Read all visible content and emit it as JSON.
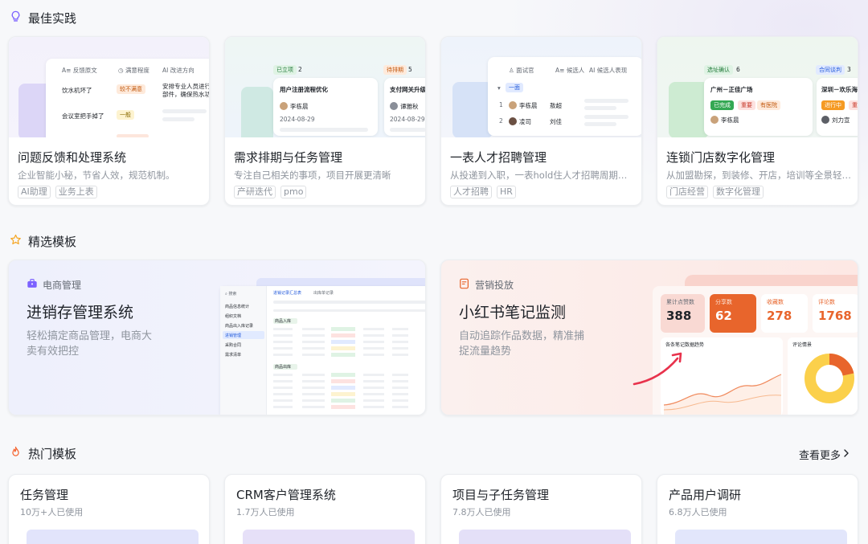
{
  "sections": {
    "best_practice": "最佳实践",
    "featured": "精选模板",
    "hot": "热门模板",
    "see_more": "查看更多"
  },
  "best_practices": [
    {
      "title": "问题反馈和处理系统",
      "desc": "企业智能小秘，节省人效，规范机制。",
      "tags": [
        "AI助理",
        "业务上表"
      ],
      "preview": {
        "headers": [
          "反馈原文",
          "满意程度",
          "改进方向"
        ],
        "rows": [
          {
            "text": "饮水机坏了",
            "level": "较不满意",
            "note": "安排专业人员进行维"
          },
          {
            "text": "",
            "level": "",
            "note": "部件，确保热水功能"
          },
          {
            "text": "会议室把手掉了",
            "level": "一般",
            "note": ""
          }
        ]
      }
    },
    {
      "title": "需求排期与任务管理",
      "desc": "专注自己相关的事项，项目开展更清晰",
      "tags": [
        "产研迭代",
        "pmo"
      ],
      "preview": {
        "col1": {
          "status": "已立项",
          "count": "2",
          "task": "用户注册流程优化",
          "person": "李栋晨",
          "date": "2024-08-29"
        },
        "col2": {
          "status": "待排期",
          "count": "5",
          "task": "支付网关升级",
          "person": "谭雅秋",
          "date": "2024-08-29"
        }
      }
    },
    {
      "title": "一表人才招聘管理",
      "desc": "从投递到入职，一表hold住人才招聘周期全流程",
      "tags": [
        "人才招聘",
        "HR"
      ],
      "preview": {
        "headers": [
          "面试官",
          "候选人",
          "候选人表现"
        ],
        "group": "一面",
        "rows": [
          {
            "no": "1",
            "interviewer": "李栋晨",
            "candidate": "敖超"
          },
          {
            "no": "2",
            "interviewer": "凌司",
            "candidate": "刘佳"
          }
        ]
      }
    },
    {
      "title": "连锁门店数字化管理",
      "desc": "从加盟勘探，到装修、开店，培训等全景轻松管理",
      "tags": [
        "门店经营",
        "数字化管理"
      ],
      "preview": {
        "col1": {
          "status": "选址确认",
          "count": "6",
          "store": "广州－正佳广场",
          "labels": [
            "已完成",
            "重要",
            "有医院"
          ],
          "person": "李栋晨"
        },
        "col2": {
          "status": "合同谈判",
          "count": "3",
          "store": "深圳－欢乐海岸",
          "labels": [
            "进行中",
            "重"
          ],
          "person": "刘力宣"
        }
      }
    }
  ],
  "featured": [
    {
      "category": "电商管理",
      "title": "进销存管理系统",
      "desc": "轻松搞定商品管理，电商大卖有效把控",
      "preview": {
        "sidebar": [
          "商品信息统计",
          "组织文档",
          "商品出入库记录",
          "进销管理",
          "采购合同",
          "需求清单"
        ],
        "tabs": [
          "进销记录汇总表",
          "出库单记录"
        ],
        "groups": [
          "商品入库",
          "商品出库"
        ]
      }
    },
    {
      "category": "营销投放",
      "title": "小红书笔记监测",
      "desc": "自动追踪作品数据，精准捕捉流量趋势",
      "preview": {
        "stats": [
          {
            "label": "累计点赞数",
            "value": "388"
          },
          {
            "label": "分享数",
            "value": "62"
          },
          {
            "label": "收藏数",
            "value": "278"
          },
          {
            "label": "评论数",
            "value": "1768"
          }
        ],
        "trend_label": "各条笔记数据趋势",
        "ring_label": "评论情景"
      }
    }
  ],
  "hot_templates": [
    {
      "title": "任务管理",
      "usage": "10万+人已使用"
    },
    {
      "title": "CRM客户管理系统",
      "usage": "1.7万人已使用"
    },
    {
      "title": "项目与子任务管理",
      "usage": "7.8万人已使用"
    },
    {
      "title": "产品用户调研",
      "usage": "6.8万人已使用"
    }
  ],
  "colors": {
    "accent": "#3370ff",
    "orange": "#e8652c",
    "card_border": "#eceef1"
  }
}
